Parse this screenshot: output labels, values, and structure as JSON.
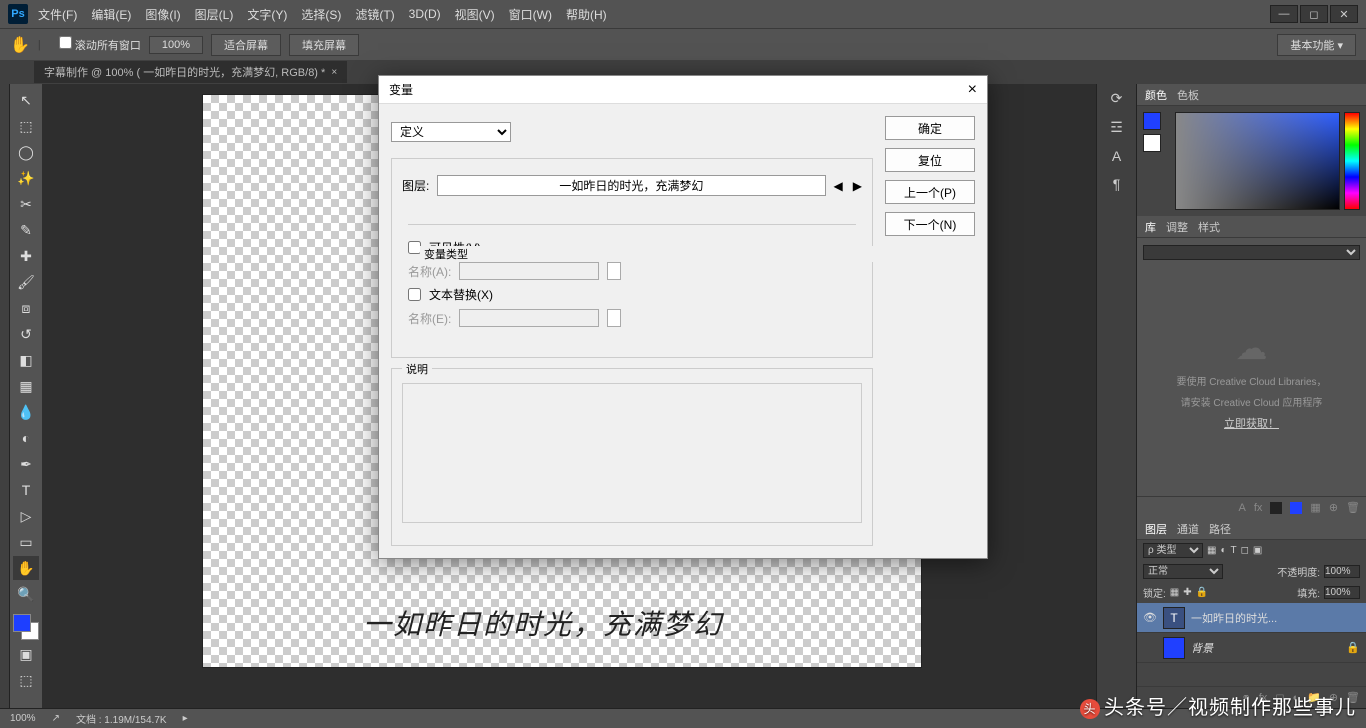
{
  "menubar": {
    "logo": "Ps",
    "items": [
      "文件(F)",
      "编辑(E)",
      "图像(I)",
      "图层(L)",
      "文字(Y)",
      "选择(S)",
      "滤镜(T)",
      "3D(D)",
      "视图(V)",
      "窗口(W)",
      "帮助(H)"
    ]
  },
  "optionsbar": {
    "scroll_all": "滚动所有窗口",
    "zoom": "100%",
    "fit_screen": "适合屏幕",
    "fill_screen": "填充屏幕",
    "workspace": "基本功能"
  },
  "tab": {
    "title": "字幕制作 @ 100% (        一如昨日的时光，充满梦幻, RGB/8) *"
  },
  "canvas": {
    "text": "一如昨日的时光，充满梦幻"
  },
  "dialog": {
    "title": "变量",
    "def_select": "定义",
    "layer_label": "图层:",
    "layer_value": "一如昨日的时光，充满梦幻",
    "vartype_legend": "变量类型",
    "visibility": "可见性(V)",
    "name_a_label": "名称(A):",
    "text_replace": "文本替换(X)",
    "name_e_label": "名称(E):",
    "desc_legend": "说明",
    "btn_ok": "确定",
    "btn_reset": "复位",
    "btn_prev": "上一个(P)",
    "btn_next": "下一个(N)"
  },
  "panels": {
    "color_tab": "颜色",
    "swatch_tab": "色板",
    "lib_tab": "库",
    "adjust_tab": "调整",
    "style_tab": "样式",
    "lib_msg1": "要使用 Creative Cloud Libraries，",
    "lib_msg2": "请安装 Creative Cloud 应用程序",
    "lib_link": "立即获取！",
    "layers_tab": "图层",
    "channels_tab": "通道",
    "paths_tab": "路径",
    "kind_label": "ρ 类型",
    "blend_mode": "正常",
    "opacity_label": "不透明度:",
    "opacity_val": "100%",
    "lock_label": "锁定:",
    "fill_label": "填充:",
    "fill_val": "100%",
    "layers": [
      {
        "name": "一如昨日的时光...",
        "type": "T",
        "visible": true,
        "active": true
      },
      {
        "name": "背景",
        "type": "blue",
        "visible": false,
        "active": false,
        "locked": true
      }
    ]
  },
  "statusbar": {
    "zoom": "100%",
    "doc": "文档 : 1.19M/154.7K"
  },
  "watermark": "头条号／视频制作那些事儿"
}
